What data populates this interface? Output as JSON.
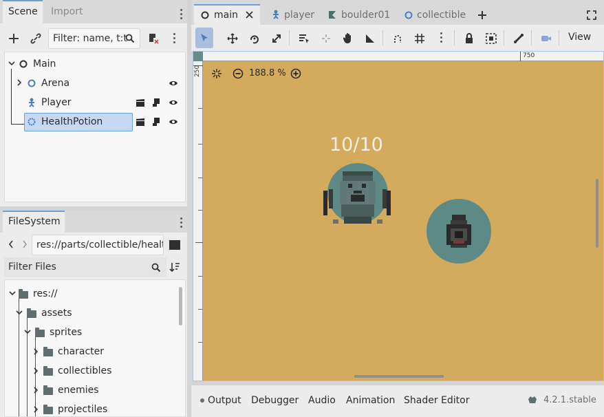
{
  "scene_dock": {
    "tabs": [
      "Scene",
      "Import"
    ],
    "filter_placeholder": "Filter: name, t:t",
    "nodes": [
      {
        "label": "Main",
        "icon": "node2d-circle-icon"
      },
      {
        "label": "Arena",
        "icon": "node2d-circle-icon"
      },
      {
        "label": "Player",
        "icon": "character-body-icon"
      },
      {
        "label": "HealthPotion",
        "icon": "area2d-icon",
        "selected": true
      }
    ]
  },
  "filesystem_dock": {
    "tab": "FileSystem",
    "path": "res://parts/collectible/healt",
    "filter_placeholder": "Filter Files",
    "items": [
      {
        "label": "res://",
        "depth": 0
      },
      {
        "label": "assets",
        "depth": 1
      },
      {
        "label": "sprites",
        "depth": 2
      },
      {
        "label": "character",
        "depth": 3
      },
      {
        "label": "collectibles",
        "depth": 3
      },
      {
        "label": "enemies",
        "depth": 3
      },
      {
        "label": "projectiles",
        "depth": 3
      }
    ]
  },
  "editor_tabs": [
    {
      "label": "main",
      "active": true,
      "icon": "scene-circle-icon"
    },
    {
      "label": "player",
      "active": false,
      "icon": "character-body-icon"
    },
    {
      "label": "boulder01",
      "active": false,
      "icon": "flag-icon"
    },
    {
      "label": "collectible",
      "active": false,
      "icon": "scene-circle-icon"
    }
  ],
  "toolbar": {
    "view_label": "View"
  },
  "viewport": {
    "zoom_label": "188.8 %",
    "ruler_top_label": "750",
    "ruler_left_label": "250",
    "health_text": "10/10",
    "background_color": "#d4aa5c"
  },
  "bottom_panel": {
    "items": [
      "Output",
      "Debugger",
      "Audio",
      "Animation",
      "Shader Editor"
    ],
    "version": "4.2.1.stable"
  },
  "colors": {
    "accent": "#6a9fd8",
    "selection": "#c6d9f2",
    "sprite_circle": "#5e8a86"
  }
}
